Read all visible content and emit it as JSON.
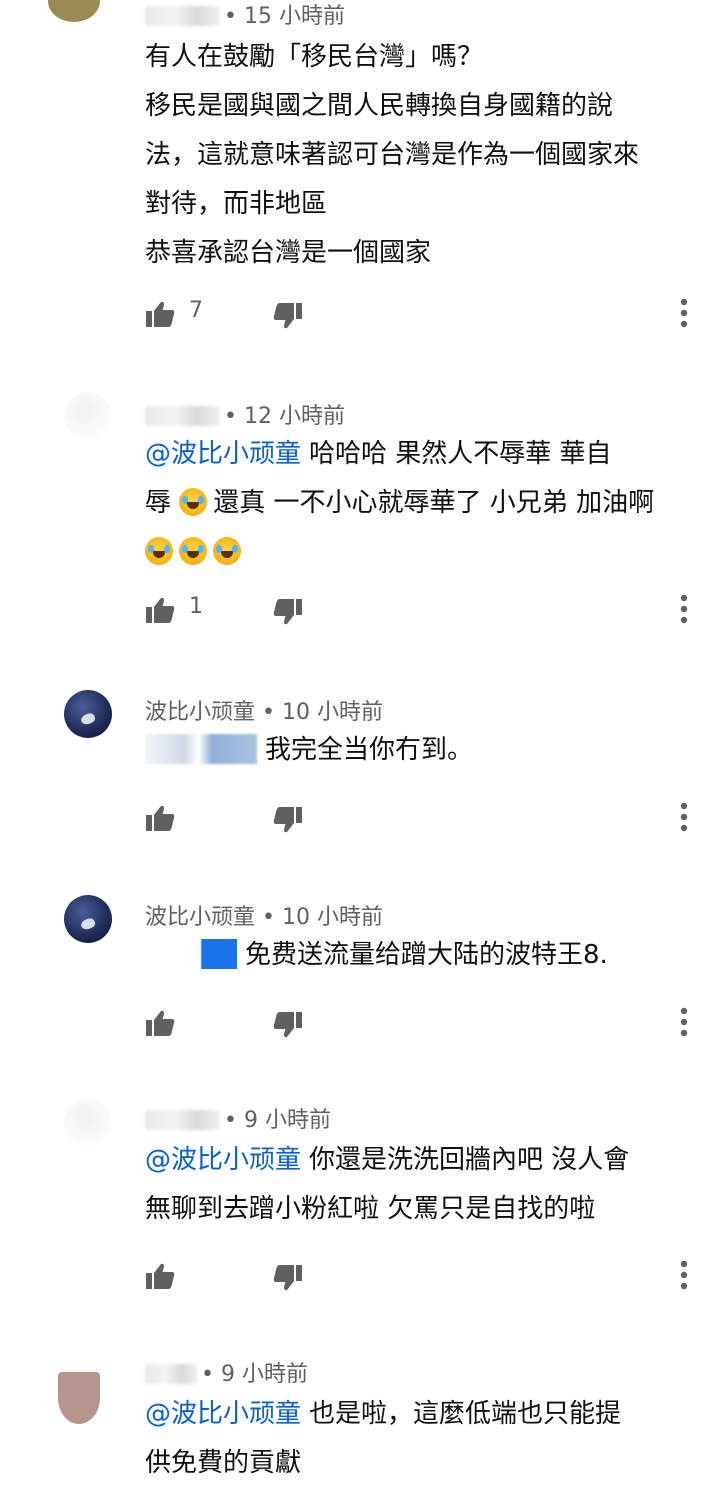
{
  "comments": [
    {
      "avatar": "olive-avatar",
      "timestamp": "15 小時前",
      "lines": [
        "有人在鼓勵「移民台灣」嗎？",
        "移民是國與國之間人民轉換自身國籍的說",
        "法，這就意味著認可台灣是作為一個國家來",
        "對待，而非地區",
        "恭喜承認台灣是一個國家"
      ],
      "likes": "7"
    },
    {
      "avatar": "blurred-avatar",
      "timestamp": "12 小時前",
      "mention": "@波比小顽童",
      "lines": [
        "哈哈哈 果然人不辱華 華自",
        "辱",
        "還真 一不小心就辱華了 小兄弟 加油啊"
      ],
      "likes": "1"
    },
    {
      "avatar": "dark-avatar",
      "author": "波比小顽童",
      "timestamp": "10 小時前",
      "text": "我完全当你冇到。",
      "likes": ""
    },
    {
      "avatar": "dark-avatar",
      "author": "波比小顽童",
      "timestamp": "10 小時前",
      "text": "免费送流量给蹭大陆的波特王8.",
      "likes": ""
    },
    {
      "avatar": "blurred-avatar",
      "timestamp": "9 小時前",
      "mention": "@波比小顽童",
      "lines": [
        "你還是洗洗回牆內吧 沒人會",
        "無聊到去蹭小粉紅啦 欠罵只是自找的啦"
      ],
      "likes": ""
    },
    {
      "avatar": "brown-avatar",
      "timestamp": "9 小時前",
      "mention": "@波比小顽童",
      "lines": [
        "也是啦，這麼低端也只能提",
        "供免費的貢獻"
      ],
      "likes": ""
    }
  ],
  "icons": {
    "like": "thumbs-up-icon",
    "dislike": "thumbs-down-icon",
    "more": "more-vertical-icon"
  },
  "colors": {
    "mention": "#065fd4",
    "meta": "#606060",
    "text": "#0f0f0f"
  }
}
